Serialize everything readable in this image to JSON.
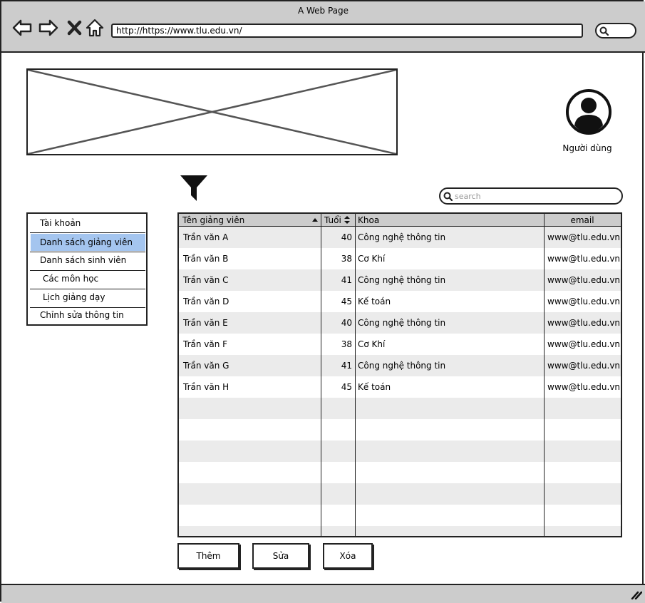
{
  "browser": {
    "title": "A Web Page",
    "url": "http://https://www.tlu.edu.vn/"
  },
  "header": {
    "user_label": "Người dùng"
  },
  "search": {
    "placeholder": "search"
  },
  "sidebar": {
    "items": [
      {
        "label": "Tài khoản",
        "selected": false
      },
      {
        "label": "Danh sách giảng viên",
        "selected": true
      },
      {
        "label": "Danh sách sinh viên",
        "selected": false
      },
      {
        "label": "Các môn học",
        "selected": false
      },
      {
        "label": "Lịch giảng dạy",
        "selected": false
      },
      {
        "label": "Chỉnh sửa thông tin",
        "selected": false
      }
    ]
  },
  "table": {
    "columns": [
      "Tên giảng viên",
      "Tuổi",
      "Khoa",
      "email"
    ],
    "rows": [
      [
        "Trần văn A",
        "40",
        "Công nghệ thông tin",
        "www@tlu.edu.vn"
      ],
      [
        "Trần văn B",
        "38",
        "Cơ Khí",
        "www@tlu.edu.vn"
      ],
      [
        "Trần văn C",
        "41",
        "Công nghệ thông tin",
        "www@tlu.edu.vn"
      ],
      [
        "Trần văn D",
        "45",
        "Kế toán",
        "www@tlu.edu.vn"
      ],
      [
        "Trần văn E",
        "40",
        "Công nghệ thông tin",
        "www@tlu.edu.vn"
      ],
      [
        "Trần văn F",
        "38",
        "Cơ Khí",
        "www@tlu.edu.vn"
      ],
      [
        "Trần văn G",
        "41",
        "Công nghệ thông tin",
        "www@tlu.edu.vn"
      ],
      [
        "Trần văn H",
        "45",
        "Kế toán",
        "www@tlu.edu.vn"
      ]
    ]
  },
  "actions": {
    "add": "Thêm",
    "edit": "Sửa",
    "delete": "Xóa"
  },
  "colors": {
    "selected": "#a4c5ef",
    "chrome": "#cccccc",
    "row_alt": "#ebebeb"
  }
}
